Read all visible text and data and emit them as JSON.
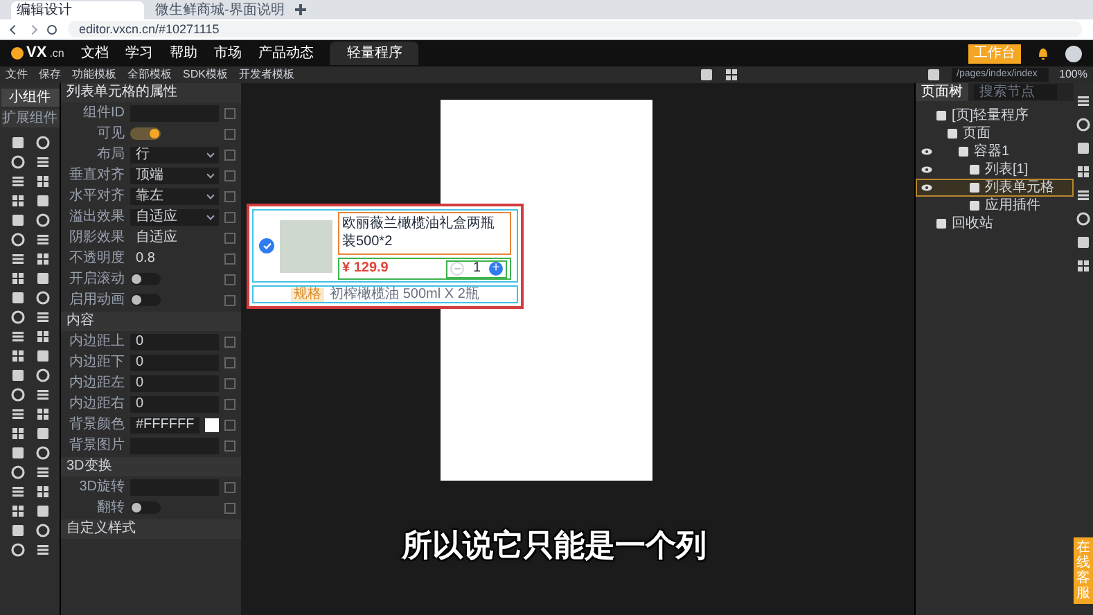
{
  "browser": {
    "tabs": [
      {
        "title": "编辑设计",
        "selected": true
      },
      {
        "title": "微生鲜商城-界面说明",
        "selected": false
      }
    ],
    "address": "editor.vxcn.cn/#10271115"
  },
  "nav": {
    "logo": "VX",
    "logo_suffix": ".cn",
    "links": [
      "文档",
      "学习",
      "帮助",
      "市场",
      "产品动态"
    ],
    "tabs": [
      {
        "label": "轻量程序",
        "selected": true
      }
    ],
    "workbench_button": "工作台"
  },
  "toolbar": {
    "items": [
      "文件",
      "保存",
      "功能模板",
      "全部模板",
      "SDK模板",
      "开发者模板"
    ],
    "page_path": "/pages/index/index",
    "zoom": "100%"
  },
  "widget_tabs": [
    {
      "label": "小组件",
      "selected": true
    },
    {
      "label": "扩展组件",
      "selected": false
    }
  ],
  "properties": {
    "title": "列表单元格的属性",
    "rows": [
      {
        "kind": "input",
        "label": "组件ID"
      },
      {
        "kind": "toggle",
        "label": "可见",
        "on": true
      },
      {
        "kind": "select",
        "label": "布局",
        "value": "行"
      },
      {
        "kind": "select",
        "label": "垂直对齐",
        "value": "顶端"
      },
      {
        "kind": "select",
        "label": "水平对齐",
        "value": "靠左"
      },
      {
        "kind": "select",
        "label": "溢出效果",
        "value": "自适应"
      },
      {
        "kind": "text",
        "label": "阴影效果",
        "value": "自适应"
      },
      {
        "kind": "text",
        "label": "不透明度",
        "value": "0.8"
      },
      {
        "kind": "toggle",
        "label": "开启滚动",
        "on": false
      },
      {
        "kind": "toggle",
        "label": "启用动画",
        "on": false
      }
    ],
    "sections": [
      {
        "title": "内容",
        "rows": [
          {
            "kind": "input",
            "label": "内边距上",
            "value": "0"
          },
          {
            "kind": "input",
            "label": "内边距下",
            "value": "0"
          },
          {
            "kind": "input",
            "label": "内边距左",
            "value": "0"
          },
          {
            "kind": "input",
            "label": "内边距右",
            "value": "0"
          },
          {
            "kind": "color",
            "label": "背景颜色",
            "value": "#FFFFFF"
          },
          {
            "kind": "input",
            "label": "背景图片"
          }
        ]
      },
      {
        "title": "3D变换",
        "rows": [
          {
            "kind": "input",
            "label": "3D旋转"
          },
          {
            "kind": "toggle",
            "label": "翻转",
            "on": false
          }
        ]
      },
      {
        "title": "自定义样式"
      }
    ]
  },
  "drag_preview": {
    "checked": true,
    "title": "欧丽薇兰橄榄油礼盒两瓶装500*2",
    "price": "¥ 129.9",
    "minus": "−",
    "quantity": "1",
    "plus": "+",
    "spec_tag": "规格",
    "spec": "初榨橄榄油 500ml X 2瓶"
  },
  "layers": {
    "tabs": [
      {
        "label": "页面树",
        "selected": true
      }
    ],
    "search_placeholder": "搜索节点",
    "tree": [
      {
        "label": "[页]轻量程序",
        "selected": false,
        "visible": false,
        "children": [
          {
            "label": "页面",
            "selected": false,
            "visible": false,
            "children": [
              {
                "label": "容器1",
                "selected": false,
                "visible": true,
                "children": [
                  {
                    "label": "列表[1]",
                    "selected": false,
                    "visible": true
                  },
                  {
                    "label": "列表单元格",
                    "selected": true,
                    "visible": true
                  },
                  {
                    "label": "应用插件",
                    "selected": false,
                    "visible": false
                  }
                ]
              }
            ]
          }
        ]
      },
      {
        "label": "回收站",
        "selected": false,
        "visible": false
      }
    ]
  },
  "help_tab": "在线客服",
  "subtitle": "所以说它只能是一个列"
}
